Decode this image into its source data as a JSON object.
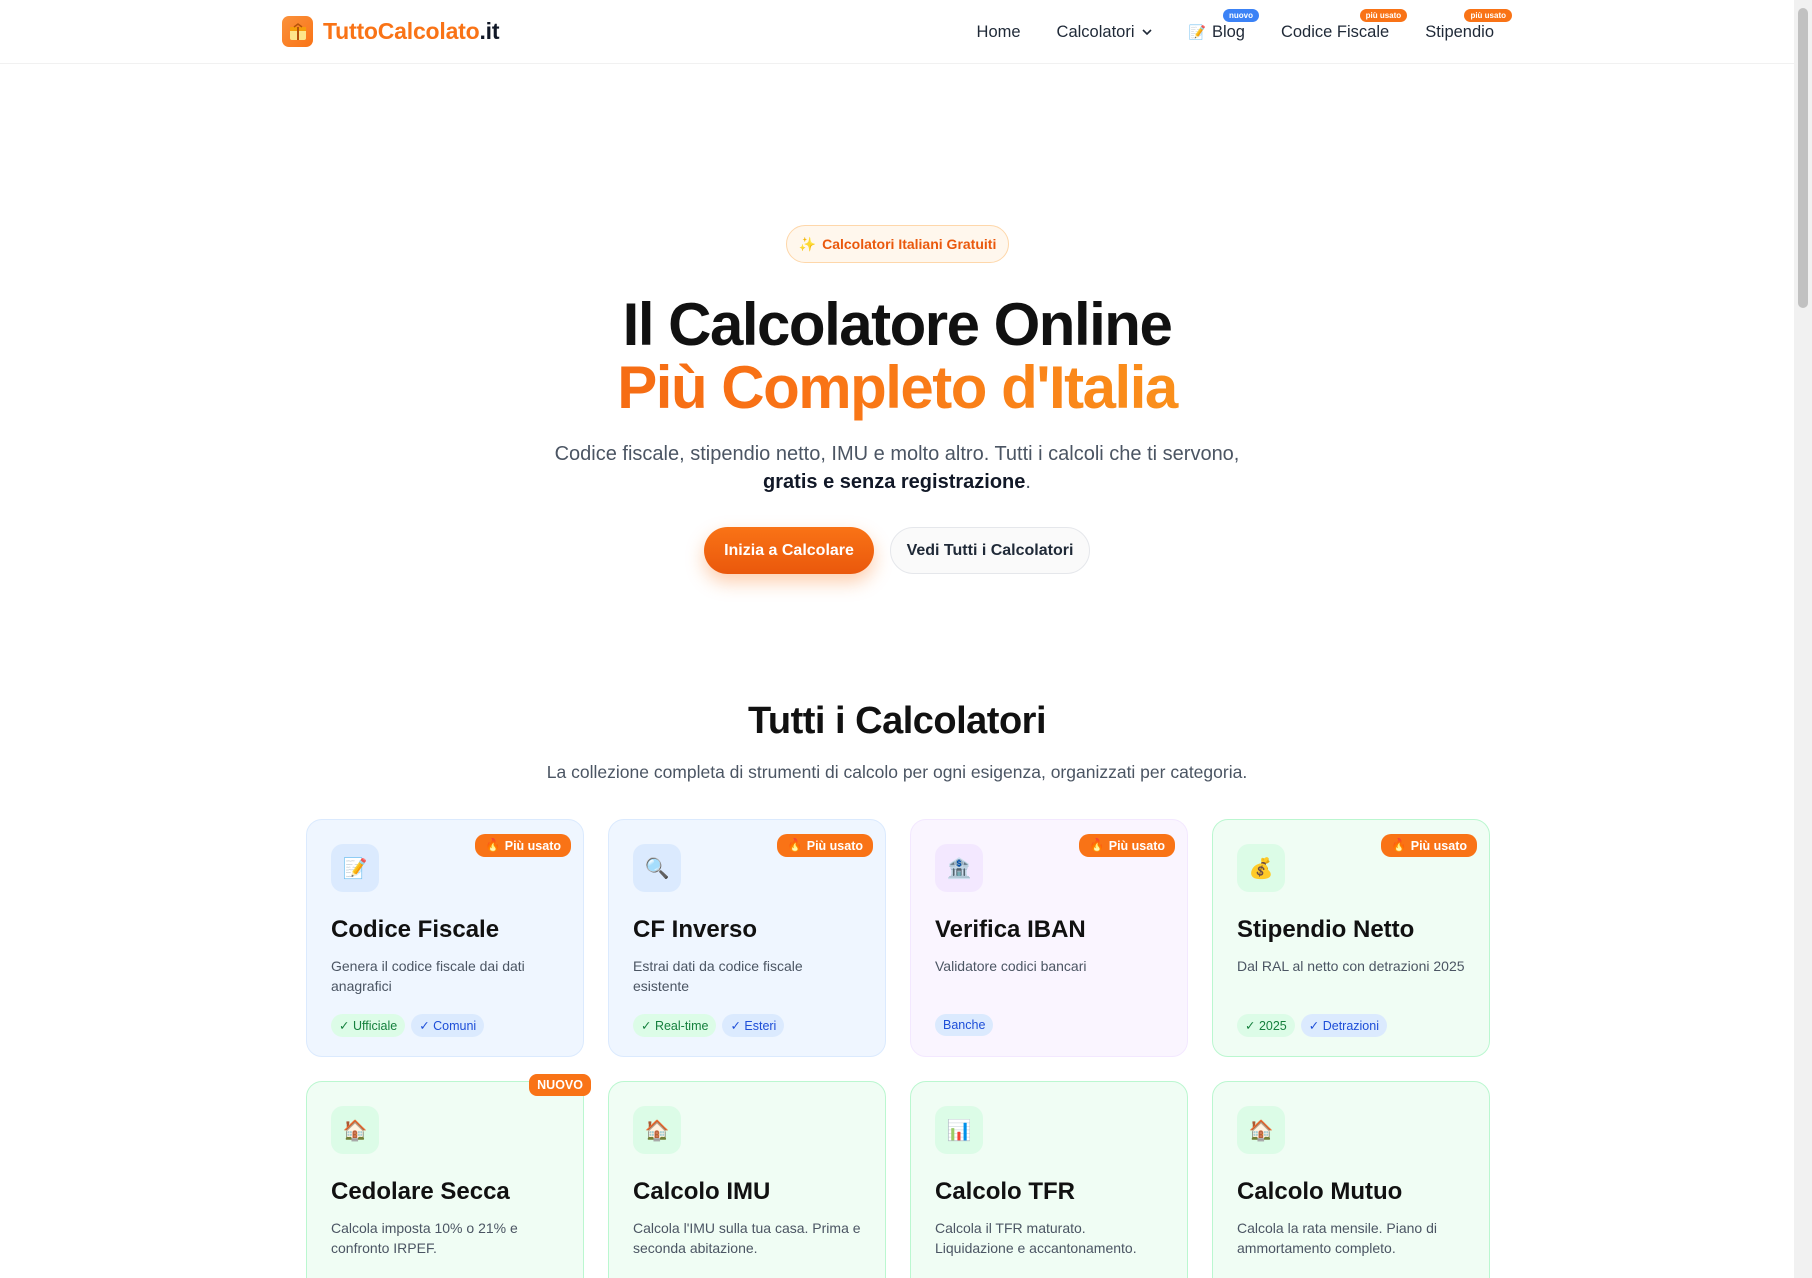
{
  "header": {
    "brand": "TuttoCalcolato",
    "tld": ".it",
    "nav": [
      {
        "label": "Home",
        "badge": ""
      },
      {
        "label": "Calcolatori",
        "badge": ""
      },
      {
        "label": "Blog",
        "badge": "nuovo"
      },
      {
        "label": "Codice Fiscale",
        "badge": "più usato"
      },
      {
        "label": "Stipendio",
        "badge": "più usato"
      }
    ]
  },
  "hero": {
    "pill": "Calcolatori Italiani Gratuiti",
    "title_line1": "Il Calcolatore Online",
    "title_line2": "Più Completo d'Italia",
    "subtitle": "Codice fiscale, stipendio netto, IMU e molto altro. Tutti i calcoli che ti servono,",
    "subtitle_bold": "gratis e senza registrazione",
    "subtitle_end": ".",
    "cta_primary": "Inizia a Calcolare",
    "cta_secondary": "Vedi Tutti i Calcolatori"
  },
  "section": {
    "title": "Tutti i Calcolatori",
    "subtitle": "La collezione completa di strumenti di calcolo per ogni esigenza, organizzati per categoria."
  },
  "cards": [
    {
      "title": "Codice Fiscale",
      "desc": "Genera il codice fiscale dai dati anagrafici",
      "badge": "Più usato",
      "icon": "memo-icon",
      "tags": [
        "✓ Ufficiale",
        "✓ Comuni"
      ]
    },
    {
      "title": "CF Inverso",
      "desc": "Estrai dati da codice fiscale esistente",
      "badge": "Più usato",
      "icon": "magnifier-icon",
      "tags": [
        "✓ Real-time",
        "✓ Esteri"
      ]
    },
    {
      "title": "Verifica IBAN",
      "desc": "Validatore codici bancari",
      "badge": "Più usato",
      "icon": "bank-icon",
      "tags": [
        "Banche"
      ]
    },
    {
      "title": "Stipendio Netto",
      "desc": "Dal RAL al netto con detrazioni 2025",
      "badge": "Più usato",
      "icon": "money-bag-icon",
      "tags": [
        "✓ 2025",
        "✓ Detrazioni"
      ]
    },
    {
      "title": "Cedolare Secca",
      "desc": "Calcola imposta 10% o 21% e confronto IRPEF.",
      "badge": "NUOVO",
      "icon": "house-icon",
      "tags": []
    },
    {
      "title": "Calcolo IMU",
      "desc": "Calcola l'IMU sulla tua casa. Prima e seconda abitazione.",
      "badge": "",
      "icon": "house-icon",
      "tags": []
    },
    {
      "title": "Calcolo TFR",
      "desc": "Calcola il TFR maturato. Liquidazione e accantonamento.",
      "badge": "",
      "icon": "bar-chart-icon",
      "tags": []
    },
    {
      "title": "Calcolo Mutuo",
      "desc": "Calcola la rata mensile. Piano di ammortamento completo.",
      "badge": "",
      "icon": "house-icon",
      "tags": []
    }
  ]
}
